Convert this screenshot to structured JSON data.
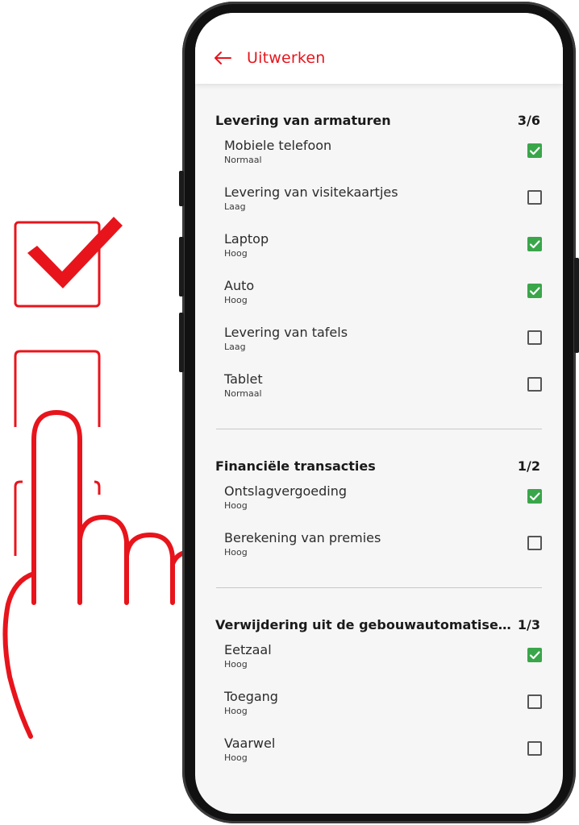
{
  "app": {
    "title": "Uitwerken",
    "back_icon": "arrow-left-icon",
    "accent_color": "#e8141c",
    "check_color": "#3aa64a"
  },
  "illustration": {
    "icons": [
      "checkbox-checked-icon",
      "checkbox-empty-icon",
      "checkbox-partial-icon",
      "hand-pointer-icon"
    ],
    "color": "#e8141c"
  },
  "sections": [
    {
      "title": "Levering van armaturen",
      "count": "3/6",
      "items": [
        {
          "label": "Mobiele telefoon",
          "priority": "Normaal",
          "checked": true
        },
        {
          "label": "Levering van visitekaartjes",
          "priority": "Laag",
          "checked": false
        },
        {
          "label": "Laptop",
          "priority": "Hoog",
          "checked": true
        },
        {
          "label": "Auto",
          "priority": "Hoog",
          "checked": true
        },
        {
          "label": "Levering van tafels",
          "priority": "Laag",
          "checked": false
        },
        {
          "label": "Tablet",
          "priority": "Normaal",
          "checked": false
        }
      ]
    },
    {
      "title": "Financiële transacties",
      "count": "1/2",
      "items": [
        {
          "label": "Ontslagvergoeding",
          "priority": "Hoog",
          "checked": true
        },
        {
          "label": "Berekening van premies",
          "priority": "Hoog",
          "checked": false
        }
      ]
    },
    {
      "title": "Verwijdering uit de gebouwautomatisering",
      "count": "1/3",
      "items": [
        {
          "label": "Eetzaal",
          "priority": "Hoog",
          "checked": true
        },
        {
          "label": "Toegang",
          "priority": "Hoog",
          "checked": false
        },
        {
          "label": "Vaarwel",
          "priority": "Hoog",
          "checked": false
        }
      ]
    }
  ]
}
